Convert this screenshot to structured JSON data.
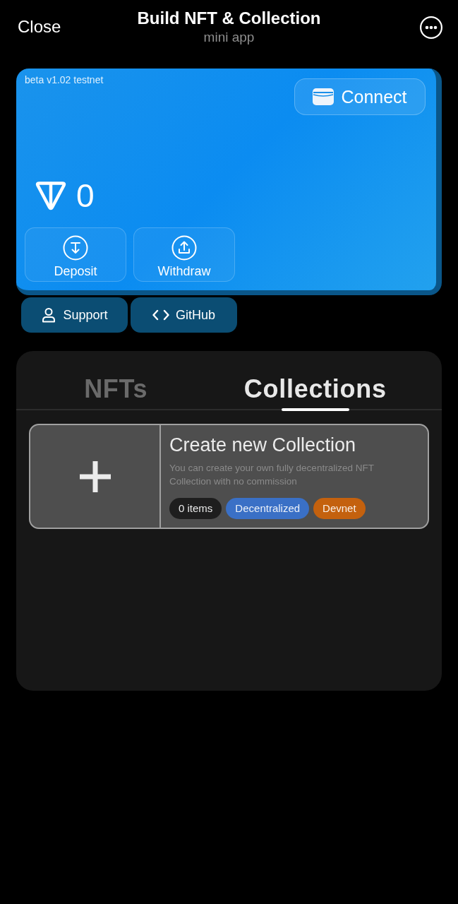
{
  "header": {
    "close": "Close",
    "title": "Build NFT & Collection",
    "subtitle": "mini app"
  },
  "wallet": {
    "version": "beta v1.02 testnet",
    "connect": "Connect",
    "balance": "0",
    "actions": [
      {
        "kind": "deposit",
        "label": "Deposit"
      },
      {
        "kind": "withdraw",
        "label": "Withdraw"
      }
    ]
  },
  "links": [
    {
      "kind": "support",
      "label": "Support"
    },
    {
      "kind": "code",
      "label": "GitHub"
    }
  ],
  "tabs": [
    {
      "label": "NFTs",
      "selected": false
    },
    {
      "label": "Collections",
      "selected": true
    }
  ],
  "collections": [
    {
      "title": "Create new Collection",
      "description": "You can create your own fully decentralized NFT Collection with no commission",
      "tags": [
        {
          "label": "0 items",
          "color": "#1e1e1e"
        },
        {
          "label": "Decentralized",
          "color": "#3a70c6"
        },
        {
          "label": "Devnet",
          "color": "#c4610e"
        }
      ]
    }
  ]
}
